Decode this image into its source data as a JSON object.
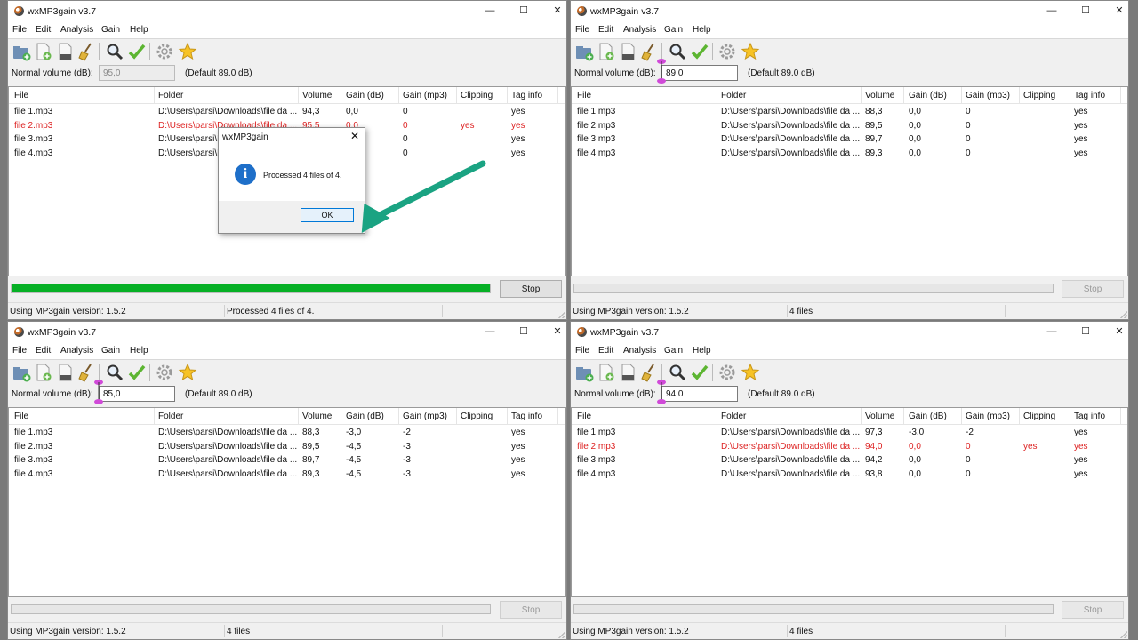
{
  "app": {
    "title": "wxMP3gain v3.7",
    "window_buttons": {
      "minimize": "—",
      "maximize": "☐",
      "close": "✕"
    },
    "menu": [
      "File",
      "Edit",
      "Analysis",
      "Gain",
      "Help"
    ],
    "volume_label": "Normal volume (dB):",
    "default_label": "(Default 89.0 dB)",
    "stop_label": "Stop",
    "status_version": "Using MP3gain version: 1.5.2",
    "columns": [
      "File",
      "Folder",
      "Volume",
      "Gain (dB)",
      "Gain (mp3)",
      "Clipping",
      "Tag info"
    ],
    "toolbar_icons": [
      "add-folder-icon",
      "add-file-icon",
      "remove-file-icon",
      "clear-broom-icon",
      "analyze-magnifier-icon",
      "apply-gain-check-icon",
      "settings-gear-icon",
      "favorite-star-icon"
    ],
    "accent_red": "#dd2222",
    "progress_color": "#06b025"
  },
  "windows": [
    {
      "volume_value": "95,0",
      "volume_disabled": true,
      "status_right": "Processed 4 files of 4.",
      "progress": 1.0,
      "stop_enabled": true,
      "rows": [
        {
          "file": "file 1.mp3",
          "folder": "D:\\Users\\parsi\\Downloads\\file da ...",
          "volume": "94,3",
          "gain_db": "0,0",
          "gain_mp3": "0",
          "clipping": "",
          "tag": "yes",
          "red": false
        },
        {
          "file": "file 2.mp3",
          "folder": "D:\\Users\\parsi\\Downloads\\file da ...",
          "volume": "95,5",
          "gain_db": "0,0",
          "gain_mp3": "0",
          "clipping": "yes",
          "tag": "yes",
          "red": true
        },
        {
          "file": "file 3.mp3",
          "folder": "D:\\Users\\parsi\\Downloads\\file da ...",
          "volume": "",
          "gain_db": "",
          "gain_mp3": "0",
          "clipping": "",
          "tag": "yes",
          "red": false
        },
        {
          "file": "file 4.mp3",
          "folder": "D:\\Users\\parsi\\Downloads\\file da ...",
          "volume": "",
          "gain_db": "",
          "gain_mp3": "0",
          "clipping": "",
          "tag": "yes",
          "red": false
        }
      ]
    },
    {
      "volume_value": "89,0",
      "volume_disabled": false,
      "status_right": "4 files",
      "progress": 0,
      "stop_enabled": false,
      "rows": [
        {
          "file": "file 1.mp3",
          "folder": "D:\\Users\\parsi\\Downloads\\file da ...",
          "volume": "88,3",
          "gain_db": "0,0",
          "gain_mp3": "0",
          "clipping": "",
          "tag": "yes",
          "red": false
        },
        {
          "file": "file 2.mp3",
          "folder": "D:\\Users\\parsi\\Downloads\\file da ...",
          "volume": "89,5",
          "gain_db": "0,0",
          "gain_mp3": "0",
          "clipping": "",
          "tag": "yes",
          "red": false
        },
        {
          "file": "file 3.mp3",
          "folder": "D:\\Users\\parsi\\Downloads\\file da ...",
          "volume": "89,7",
          "gain_db": "0,0",
          "gain_mp3": "0",
          "clipping": "",
          "tag": "yes",
          "red": false
        },
        {
          "file": "file 4.mp3",
          "folder": "D:\\Users\\parsi\\Downloads\\file da ...",
          "volume": "89,3",
          "gain_db": "0,0",
          "gain_mp3": "0",
          "clipping": "",
          "tag": "yes",
          "red": false
        }
      ]
    },
    {
      "volume_value": "85,0",
      "volume_disabled": false,
      "status_right": "4 files",
      "progress": 0,
      "stop_enabled": false,
      "rows": [
        {
          "file": "file 1.mp3",
          "folder": "D:\\Users\\parsi\\Downloads\\file da ...",
          "volume": "88,3",
          "gain_db": "-3,0",
          "gain_mp3": "-2",
          "clipping": "",
          "tag": "yes",
          "red": false
        },
        {
          "file": "file 2.mp3",
          "folder": "D:\\Users\\parsi\\Downloads\\file da ...",
          "volume": "89,5",
          "gain_db": "-4,5",
          "gain_mp3": "-3",
          "clipping": "",
          "tag": "yes",
          "red": false
        },
        {
          "file": "file 3.mp3",
          "folder": "D:\\Users\\parsi\\Downloads\\file da ...",
          "volume": "89,7",
          "gain_db": "-4,5",
          "gain_mp3": "-3",
          "clipping": "",
          "tag": "yes",
          "red": false
        },
        {
          "file": "file 4.mp3",
          "folder": "D:\\Users\\parsi\\Downloads\\file da ...",
          "volume": "89,3",
          "gain_db": "-4,5",
          "gain_mp3": "-3",
          "clipping": "",
          "tag": "yes",
          "red": false
        }
      ]
    },
    {
      "volume_value": "94,0",
      "volume_disabled": false,
      "status_right": "4 files",
      "progress": 0,
      "stop_enabled": false,
      "rows": [
        {
          "file": "file 1.mp3",
          "folder": "D:\\Users\\parsi\\Downloads\\file da ...",
          "volume": "97,3",
          "gain_db": "-3,0",
          "gain_mp3": "-2",
          "clipping": "",
          "tag": "yes",
          "red": false
        },
        {
          "file": "file 2.mp3",
          "folder": "D:\\Users\\parsi\\Downloads\\file da ...",
          "volume": "94,0",
          "gain_db": "0,0",
          "gain_mp3": "0",
          "clipping": "yes",
          "tag": "yes",
          "red": true
        },
        {
          "file": "file 3.mp3",
          "folder": "D:\\Users\\parsi\\Downloads\\file da ...",
          "volume": "94,2",
          "gain_db": "0,0",
          "gain_mp3": "0",
          "clipping": "",
          "tag": "yes",
          "red": false
        },
        {
          "file": "file 4.mp3",
          "folder": "D:\\Users\\parsi\\Downloads\\file da ...",
          "volume": "93,8",
          "gain_db": "0,0",
          "gain_mp3": "0",
          "clipping": "",
          "tag": "yes",
          "red": false
        }
      ]
    }
  ],
  "dialog": {
    "title": "wxMP3gain",
    "close": "✕",
    "icon": "i",
    "message": "Processed 4 files of 4.",
    "ok_label": "OK"
  }
}
